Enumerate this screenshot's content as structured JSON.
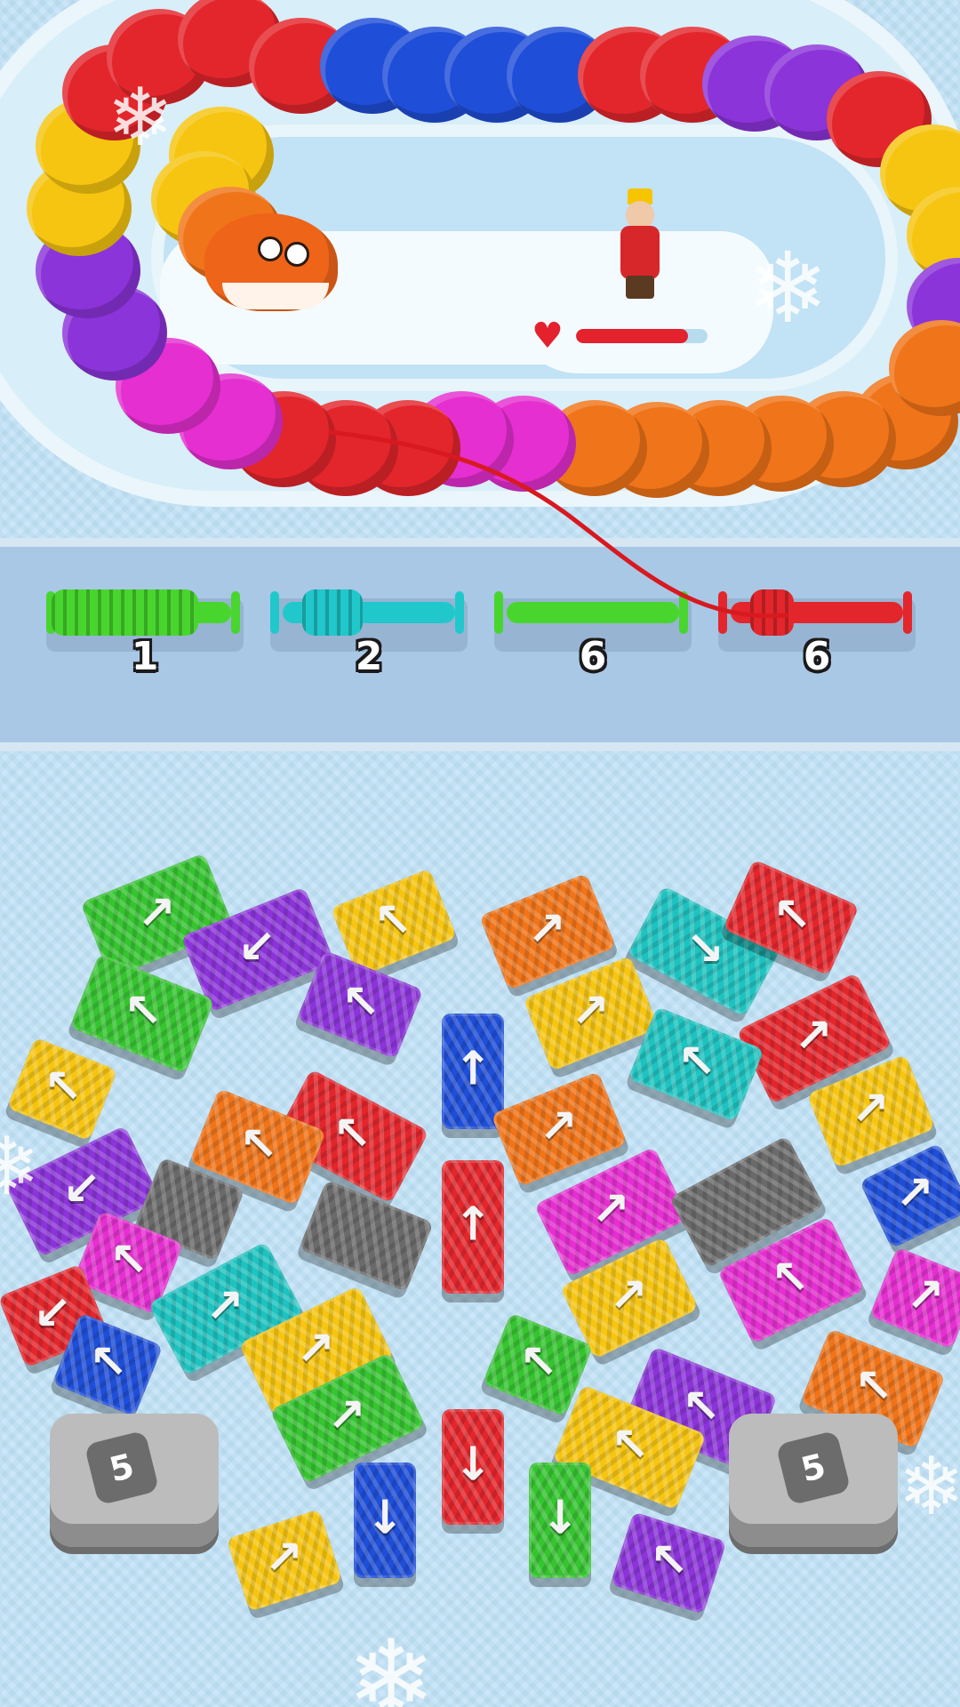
{
  "colors": {
    "red": "#e3262c",
    "orange": "#f07419",
    "yellow": "#f6c511",
    "green": "#36c431",
    "cyan": "#1ec3c0",
    "blue": "#1f4ed8",
    "purple": "#8b34d9",
    "magenta": "#e52fd0",
    "gray": "#6a6a6a",
    "light_green": "#4ee040"
  },
  "health": {
    "icon": "heart-icon",
    "fill_fraction": 0.85
  },
  "spools": [
    {
      "count": "1",
      "color": "#48d62e",
      "fill_fraction": 0.85
    },
    {
      "count": "2",
      "color": "#20c8cc",
      "fill_fraction": 0.35
    },
    {
      "count": "6",
      "color": "#48d62e",
      "fill_fraction": 0.0
    },
    {
      "count": "6",
      "color": "#e3262c",
      "fill_fraction": 0.25
    }
  ],
  "counters": [
    {
      "label": "5"
    },
    {
      "label": "5"
    }
  ],
  "blocks": [
    {
      "color": "green",
      "direction": "up-right"
    },
    {
      "color": "purple",
      "direction": "down-left"
    },
    {
      "color": "yellow",
      "direction": "up-left"
    },
    {
      "color": "orange",
      "direction": "up-right"
    },
    {
      "color": "cyan",
      "direction": "down-right"
    },
    {
      "color": "red",
      "direction": "up-left"
    },
    {
      "color": "green",
      "direction": "up-left"
    },
    {
      "color": "purple",
      "direction": "up-left"
    },
    {
      "color": "blue",
      "direction": "up"
    },
    {
      "color": "yellow",
      "direction": "up-right"
    },
    {
      "color": "red",
      "direction": "up-right"
    },
    {
      "color": "yellow",
      "direction": "up-left"
    },
    {
      "color": "red",
      "direction": "up-left"
    },
    {
      "color": "orange",
      "direction": "up-left"
    },
    {
      "color": "orange",
      "direction": "up-right"
    },
    {
      "color": "cyan",
      "direction": "up-left"
    },
    {
      "color": "yellow",
      "direction": "up-right"
    },
    {
      "color": "purple",
      "direction": "down-left"
    },
    {
      "color": "gray",
      "direction": "none"
    },
    {
      "color": "gray",
      "direction": "none"
    },
    {
      "color": "red",
      "direction": "up"
    },
    {
      "color": "magenta",
      "direction": "up-right"
    },
    {
      "color": "gray",
      "direction": "none"
    },
    {
      "color": "blue",
      "direction": "up-right"
    },
    {
      "color": "magenta",
      "direction": "up-left"
    },
    {
      "color": "cyan",
      "direction": "up-right"
    },
    {
      "color": "yellow",
      "direction": "up-right"
    },
    {
      "color": "yellow",
      "direction": "up-right"
    },
    {
      "color": "magenta",
      "direction": "up-left"
    },
    {
      "color": "red",
      "direction": "down-left"
    },
    {
      "color": "blue",
      "direction": "up-left"
    },
    {
      "color": "magenta",
      "direction": "up-right"
    },
    {
      "color": "green",
      "direction": "up-left"
    },
    {
      "color": "purple",
      "direction": "up-left"
    },
    {
      "color": "orange",
      "direction": "up-left"
    },
    {
      "color": "green",
      "direction": "up-right"
    },
    {
      "color": "yellow",
      "direction": "up-left"
    },
    {
      "color": "red",
      "direction": "down"
    },
    {
      "color": "blue",
      "direction": "down"
    },
    {
      "color": "green",
      "direction": "down"
    },
    {
      "color": "yellow",
      "direction": "up-right"
    },
    {
      "color": "purple",
      "direction": "up-left"
    }
  ]
}
